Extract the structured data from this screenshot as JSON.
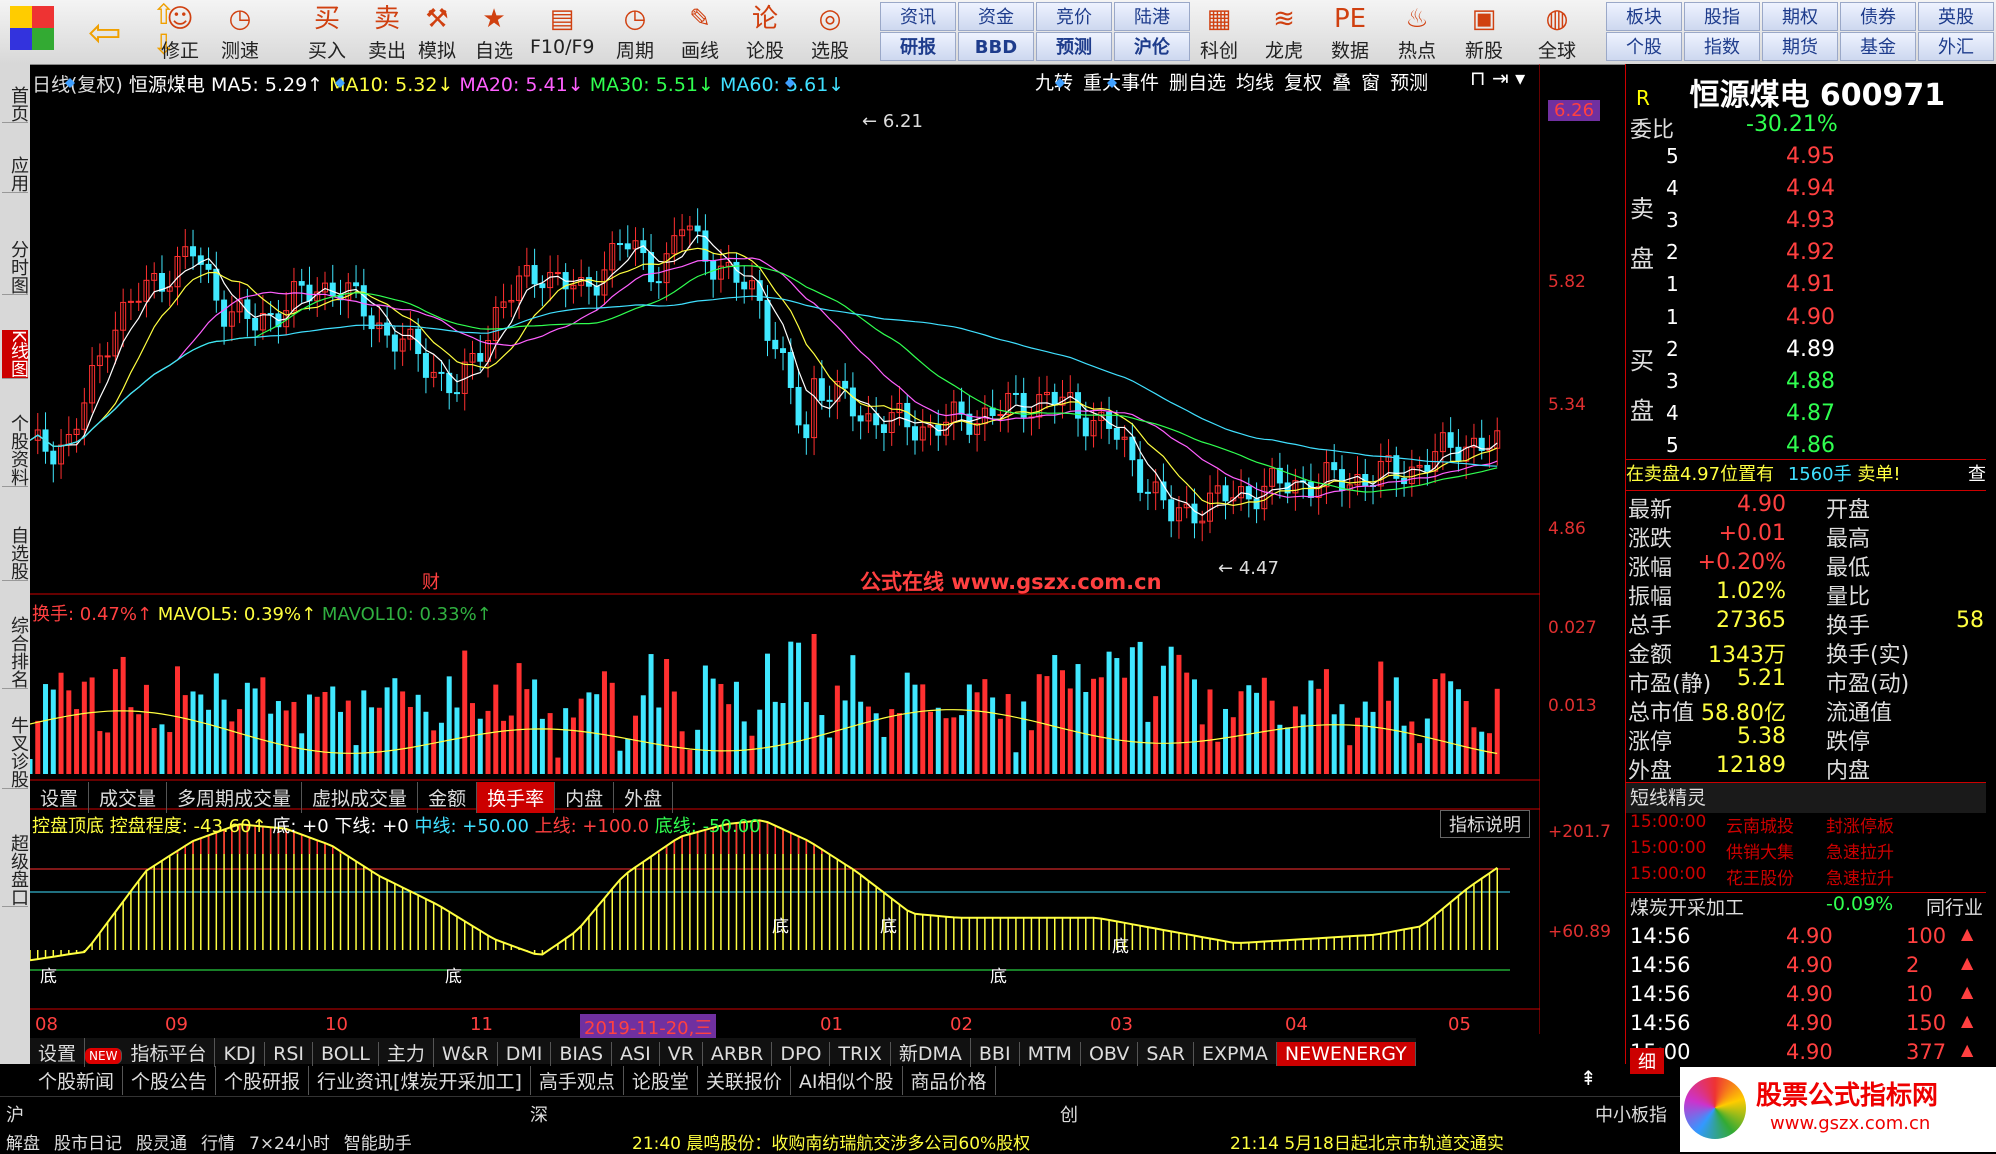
{
  "toolbar": {
    "buttons": [
      {
        "label": "修正",
        "icon": "arrow-up-down-icon"
      },
      {
        "label": "测速",
        "icon": "clock-icon"
      },
      {
        "label": "买入",
        "icon": "buy-icon"
      },
      {
        "label": "卖出",
        "icon": "sell-icon"
      },
      {
        "label": "模拟",
        "icon": "hammer-icon"
      },
      {
        "label": "自选",
        "icon": "star-icon"
      },
      {
        "label": "F10/F9",
        "icon": "document-icon"
      },
      {
        "label": "周期",
        "icon": "clock-icon"
      },
      {
        "label": "画线",
        "icon": "pencil-icon"
      },
      {
        "label": "论股",
        "icon": "forum-icon"
      },
      {
        "label": "选股",
        "icon": "magnifier-chart-icon"
      },
      {
        "label": "科创",
        "icon": "chart-icon"
      },
      {
        "label": "龙虎",
        "icon": "dragon-icon"
      },
      {
        "label": "数据",
        "icon": "pe-icon"
      },
      {
        "label": "热点",
        "icon": "hot-icon"
      },
      {
        "label": "新股",
        "icon": "ipo-icon"
      },
      {
        "label": "全球",
        "icon": "globe-icon"
      }
    ],
    "grid_top": [
      "资讯",
      "资金",
      "竞价",
      "陆港"
    ],
    "grid_bottom": [
      "研报",
      "BBD",
      "预测",
      "沪伦"
    ],
    "right_grid_top": [
      "板块",
      "股指",
      "期权",
      "债券",
      "英股"
    ],
    "right_grid_bottom": [
      "个股",
      "指数",
      "期货",
      "基金",
      "外汇"
    ]
  },
  "left_tabs": [
    "首页",
    "应用",
    "分时图",
    "K线图",
    "个股资料",
    "自选股",
    "综合排名",
    "牛叉诊股",
    "超级盘口"
  ],
  "chart": {
    "header": {
      "period": "日线(复权)",
      "name": "恒源煤电",
      "ma5": "MA5: 5.29↑",
      "ma10": "MA10: 5.32↓",
      "ma20": "MA20: 5.41↓",
      "ma30": "MA30: 5.51↓",
      "ma60": "MA60: 5.61↓"
    },
    "top_buttons": [
      "九转",
      "重大事件",
      "删自选",
      "均线",
      "复权",
      "叠",
      "窗",
      "预测"
    ],
    "price_axis": [
      "6.21",
      "5.82",
      "5.34",
      "4.86"
    ],
    "price_tag": "6.26",
    "high_label": "6.21",
    "low_label": "4.47",
    "fin_label": "财",
    "watermark": "公式在线  www.gszx.com.cn",
    "vol_header": {
      "a": "换手: 0.47%↑",
      "b": "MAVOL5: 0.39%↑",
      "c": "MAVOL10: 0.33%↑"
    },
    "vol_axis": [
      "0.027",
      "0.013"
    ],
    "mid_tabs": [
      "设置",
      "成交量",
      "多周期成交量",
      "虚拟成交量",
      "金额",
      "换手率",
      "内盘",
      "外盘"
    ],
    "ind_header": {
      "title": "控盘顶底",
      "a": "控盘程度: -43.60↑",
      "b": "底: +0",
      "c": "下线: +0",
      "d": "中线: +50.00",
      "e": "上线: +100.0",
      "f": "底线: -50.00"
    },
    "ind_help": "指标说明",
    "ind_axis": [
      "+201.7",
      "+60.89"
    ],
    "bottom_label_di": "底",
    "date_axis": [
      "08",
      "09",
      "10",
      "11",
      "01",
      "02",
      "03",
      "04",
      "05"
    ],
    "date_highlight": "2019-11-20,三",
    "indicator_tabs": [
      "设置",
      "NEW",
      "指标平台",
      "KDJ",
      "RSI",
      "BOLL",
      "主力",
      "W&R",
      "DMI",
      "BIAS",
      "ASI",
      "VR",
      "ARBR",
      "DPO",
      "TRIX",
      "新DMA",
      "BBI",
      "MTM",
      "OBV",
      "SAR",
      "EXPMA",
      "NEWENERGY"
    ],
    "news_tabs": [
      "个股新闻",
      "个股公告",
      "个股研报",
      "行业资讯[煤炭开采加工]",
      "高手观点",
      "论股堂",
      "关联报价",
      "AI相似个股",
      "商品价格"
    ]
  },
  "right_panel": {
    "r_mark": "R",
    "stock_title": "恒源煤电 600971",
    "weibi_label": "委比",
    "weibi_value": "-30.21%",
    "sell_label": "卖盘",
    "buy_label": "买盘",
    "sells": [
      {
        "n": "5",
        "p": "4.95"
      },
      {
        "n": "4",
        "p": "4.94"
      },
      {
        "n": "3",
        "p": "4.93"
      },
      {
        "n": "2",
        "p": "4.92"
      },
      {
        "n": "1",
        "p": "4.91"
      }
    ],
    "buys": [
      {
        "n": "1",
        "p": "4.90"
      },
      {
        "n": "2",
        "p": "4.89"
      },
      {
        "n": "3",
        "p": "4.88"
      },
      {
        "n": "4",
        "p": "4.87"
      },
      {
        "n": "5",
        "p": "4.86"
      }
    ],
    "notice": "在卖盘4.97位置有",
    "notice_qty": "1560手",
    "notice_tail": "卖单!",
    "notice_btn": "查",
    "stats": [
      {
        "l": "最新",
        "v": "4.90",
        "l2": "开盘"
      },
      {
        "l": "涨跌",
        "v": "+0.01",
        "l2": "最高"
      },
      {
        "l": "涨幅",
        "v": "+0.20%",
        "l2": "最低"
      },
      {
        "l": "振幅",
        "v": "1.02%",
        "l2": "量比"
      },
      {
        "l": "总手",
        "v": "27365",
        "l2": "换手"
      },
      {
        "l": "金额",
        "v": "1343万",
        "l2": "换手(实)"
      },
      {
        "l": "市盈(静)",
        "v": "5.21",
        "l2": "市盈(动)"
      },
      {
        "l": "总市值",
        "v": "58.80亿",
        "l2": "流通值"
      },
      {
        "l": "涨停",
        "v": "5.38",
        "l2": "跌停"
      },
      {
        "l": "外盘",
        "v": "12189",
        "l2": "内盘"
      }
    ],
    "float_value_partial": "58",
    "short_title": "短线精灵",
    "short_items": [
      {
        "t": "15:00:00",
        "n": "云南城投",
        "e": "封涨停板"
      },
      {
        "t": "15:00:00",
        "n": "供销大集",
        "e": "急速拉升"
      },
      {
        "t": "15:00:00",
        "n": "花王股份",
        "e": "急速拉升"
      }
    ],
    "industry": "煤炭开采加工",
    "industry_change": "-0.09%",
    "industry_btn": "同行业",
    "ticks": [
      {
        "t": "14:56",
        "p": "4.90",
        "v": "100"
      },
      {
        "t": "14:56",
        "p": "4.90",
        "v": "2"
      },
      {
        "t": "14:56",
        "p": "4.90",
        "v": "10"
      },
      {
        "t": "14:56",
        "p": "4.90",
        "v": "150"
      },
      {
        "t": "15:00",
        "p": "4.90",
        "v": "377"
      }
    ],
    "detail_btn": "细"
  },
  "bottom_bar": {
    "markets": [
      "沪",
      "深",
      "创"
    ],
    "sme": "中小板指",
    "items": [
      "解盘",
      "股市日记",
      "股灵通",
      "行情",
      "7×24小时",
      "智能助手"
    ],
    "news1": "21:40 晨鸣股份：收购南纺瑞航交涉多公司60%股权",
    "news2": "21:14 5月18日起北京市轨道交通实",
    "logo_text": "股票公式指标网",
    "logo_url": "www.gszx.com.cn"
  },
  "colors": {
    "up": "#ff3030",
    "down": "#40e8ff",
    "ma5": "#ffffff",
    "ma10": "#ffff40",
    "ma20": "#ff60ff",
    "ma30": "#30ff50",
    "ma60": "#40e0ff"
  }
}
